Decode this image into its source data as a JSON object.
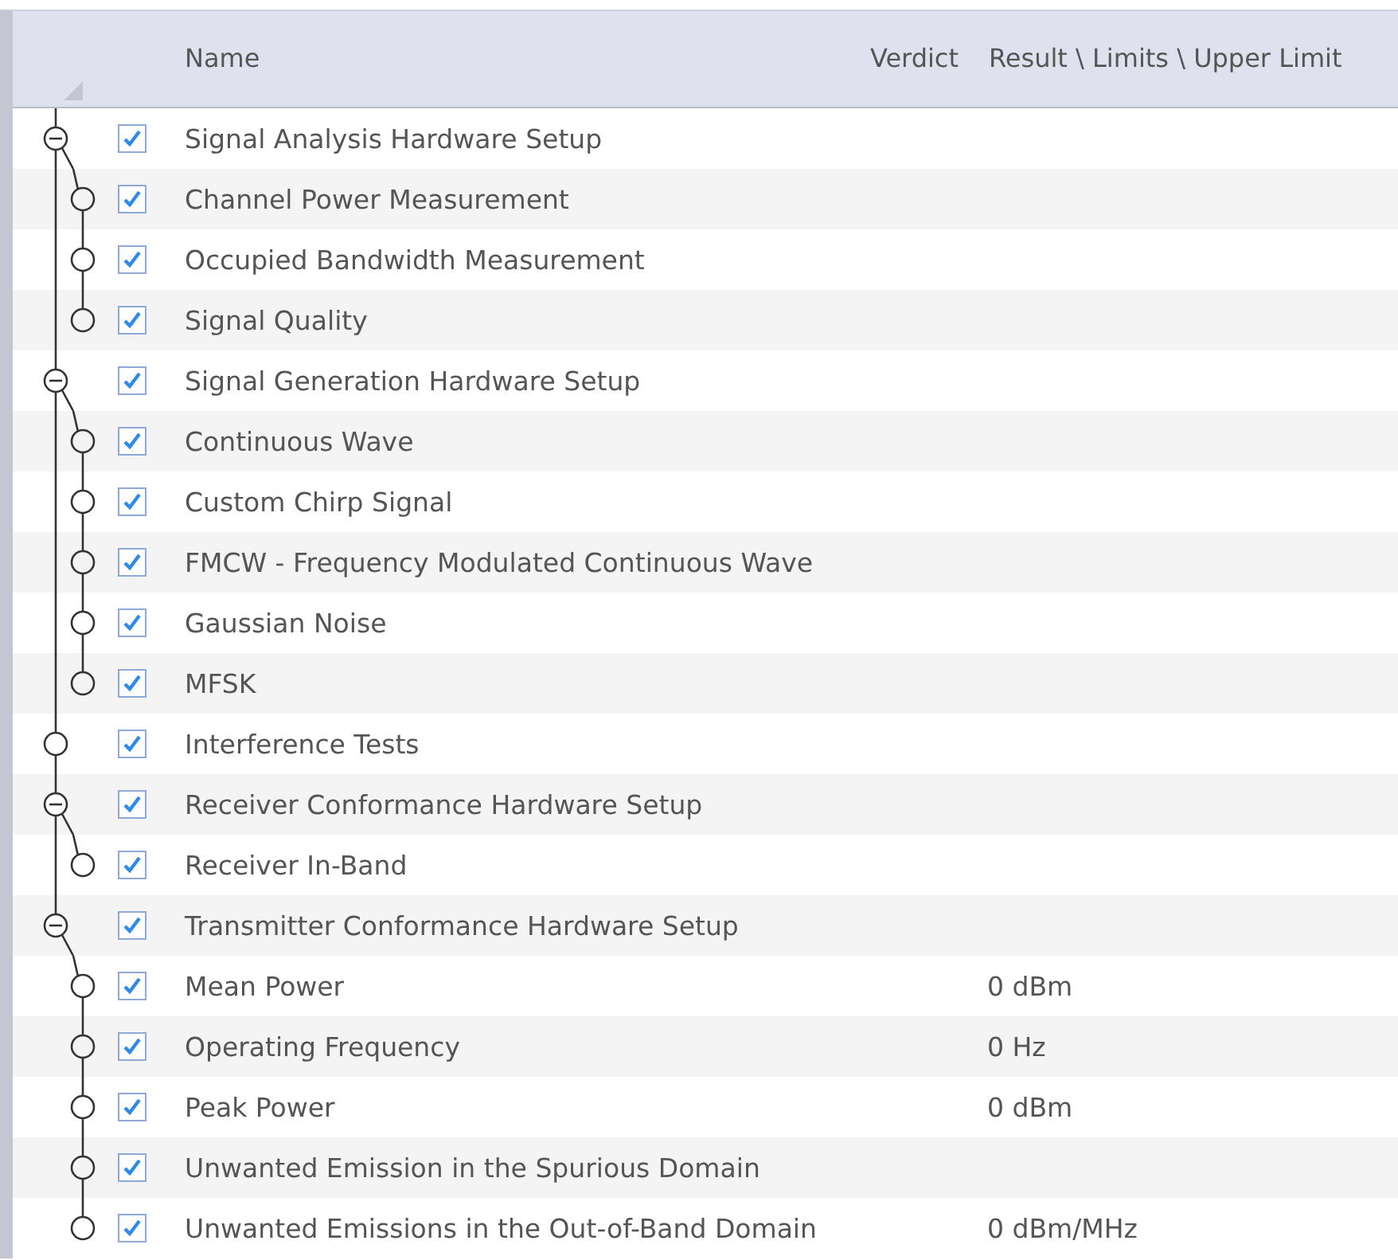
{
  "columns": [
    {
      "kind": "name",
      "label": "Name"
    },
    {
      "kind": "verdict",
      "label": "Verdict"
    },
    {
      "kind": "result",
      "label": "Result \\ Limits \\ Upper Limit"
    }
  ],
  "items": [
    {
      "name": "Signal Analysis Hardware Setup",
      "checked": true,
      "expanded": true,
      "children": [
        {
          "name": "Channel Power Measurement",
          "checked": true
        },
        {
          "name": "Occupied Bandwidth Measurement",
          "checked": true
        },
        {
          "name": "Signal Quality",
          "checked": true
        }
      ]
    },
    {
      "name": "Signal Generation Hardware Setup",
      "checked": true,
      "expanded": true,
      "children": [
        {
          "name": "Continuous Wave",
          "checked": true
        },
        {
          "name": "Custom Chirp Signal",
          "checked": true
        },
        {
          "name": "FMCW - Frequency Modulated Continuous Wave",
          "checked": true
        },
        {
          "name": "Gaussian Noise",
          "checked": true
        },
        {
          "name": "MFSK",
          "checked": true
        }
      ]
    },
    {
      "name": "Interference Tests",
      "checked": true
    },
    {
      "name": "Receiver Conformance Hardware Setup",
      "checked": true,
      "expanded": true,
      "children": [
        {
          "name": "Receiver  In-Band",
          "checked": true
        }
      ]
    },
    {
      "name": "Transmitter Conformance Hardware Setup",
      "checked": true,
      "expanded": true,
      "children": [
        {
          "name": "Mean Power",
          "checked": true,
          "result": "0 dBm"
        },
        {
          "name": "Operating Frequency",
          "checked": true,
          "result": "0 Hz"
        },
        {
          "name": "Peak Power",
          "checked": true,
          "result": "0 dBm"
        },
        {
          "name": "Unwanted Emission in the Spurious Domain",
          "checked": true
        },
        {
          "name": "Unwanted Emissions in the Out-of-Band Domain",
          "checked": true,
          "result": "0 dBm/MHz"
        }
      ]
    }
  ]
}
